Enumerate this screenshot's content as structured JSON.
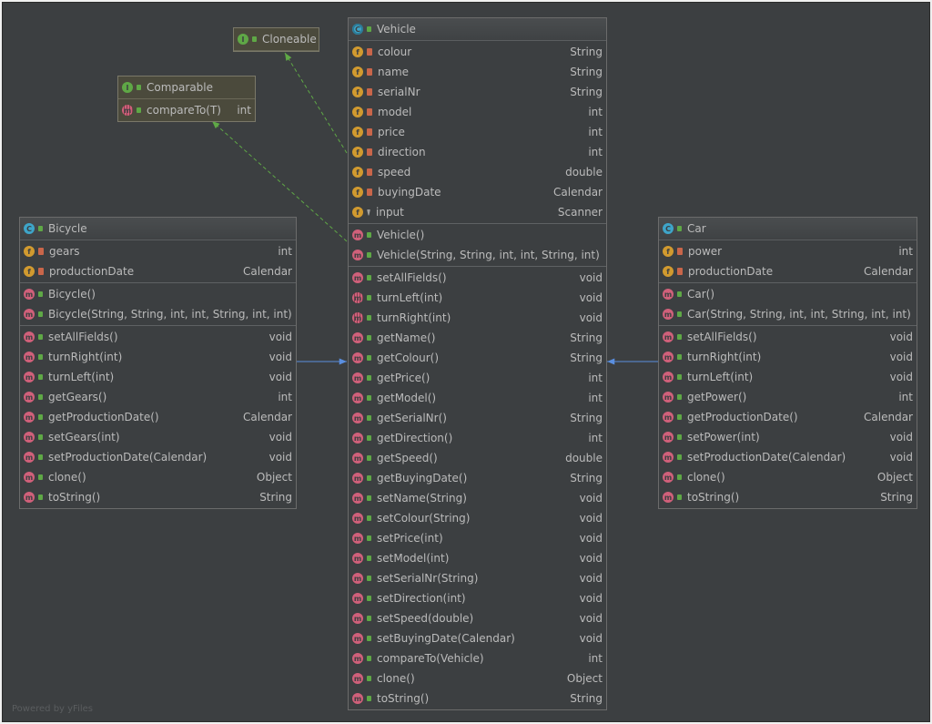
{
  "footer": "Powered by yFiles",
  "colors": {
    "background": "#3c3f41",
    "inheritance": "#5a8fe0",
    "realization": "#5fa846"
  },
  "classes": {
    "vehicle": {
      "name": "Vehicle",
      "kind": "abstract-class",
      "fields": [
        [
          "colour",
          "String",
          "private"
        ],
        [
          "name",
          "String",
          "private"
        ],
        [
          "serialNr",
          "String",
          "private"
        ],
        [
          "model",
          "int",
          "private"
        ],
        [
          "price",
          "int",
          "private"
        ],
        [
          "direction",
          "int",
          "private"
        ],
        [
          "speed",
          "double",
          "private"
        ],
        [
          "buyingDate",
          "Calendar",
          "private"
        ],
        [
          "input",
          "Scanner",
          "package"
        ]
      ],
      "constructors": [
        [
          "Vehicle()",
          "",
          "public"
        ],
        [
          "Vehicle(String, String, int, int, String, int)",
          "",
          "public"
        ]
      ],
      "methods": [
        [
          "setAllFields()",
          "void",
          "public"
        ],
        [
          "turnLeft(int)",
          "void",
          "public",
          "abstract"
        ],
        [
          "turnRight(int)",
          "void",
          "public",
          "abstract"
        ],
        [
          "getName()",
          "String",
          "public"
        ],
        [
          "getColour()",
          "String",
          "public"
        ],
        [
          "getPrice()",
          "int",
          "public"
        ],
        [
          "getModel()",
          "int",
          "public"
        ],
        [
          "getSerialNr()",
          "String",
          "public"
        ],
        [
          "getDirection()",
          "int",
          "public"
        ],
        [
          "getSpeed()",
          "double",
          "public"
        ],
        [
          "getBuyingDate()",
          "String",
          "public"
        ],
        [
          "setName(String)",
          "void",
          "public"
        ],
        [
          "setColour(String)",
          "void",
          "public"
        ],
        [
          "setPrice(int)",
          "void",
          "public"
        ],
        [
          "setModel(int)",
          "void",
          "public"
        ],
        [
          "setSerialNr(String)",
          "void",
          "public"
        ],
        [
          "setDirection(int)",
          "void",
          "public"
        ],
        [
          "setSpeed(double)",
          "void",
          "public"
        ],
        [
          "setBuyingDate(Calendar)",
          "void",
          "public"
        ],
        [
          "compareTo(Vehicle)",
          "int",
          "public"
        ],
        [
          "clone()",
          "Object",
          "public"
        ],
        [
          "toString()",
          "String",
          "public"
        ]
      ]
    },
    "bicycle": {
      "name": "Bicycle",
      "kind": "class",
      "fields": [
        [
          "gears",
          "int",
          "private"
        ],
        [
          "productionDate",
          "Calendar",
          "private"
        ]
      ],
      "constructors": [
        [
          "Bicycle()",
          "",
          "public"
        ],
        [
          "Bicycle(String, String, int, int, String, int, int)",
          "",
          "public"
        ]
      ],
      "methods": [
        [
          "setAllFields()",
          "void",
          "public"
        ],
        [
          "turnRight(int)",
          "void",
          "public"
        ],
        [
          "turnLeft(int)",
          "void",
          "public"
        ],
        [
          "getGears()",
          "int",
          "public"
        ],
        [
          "getProductionDate()",
          "Calendar",
          "public"
        ],
        [
          "setGears(int)",
          "void",
          "public"
        ],
        [
          "setProductionDate(Calendar)",
          "void",
          "public"
        ],
        [
          "clone()",
          "Object",
          "public"
        ],
        [
          "toString()",
          "String",
          "public"
        ]
      ]
    },
    "car": {
      "name": "Car",
      "kind": "class",
      "fields": [
        [
          "power",
          "int",
          "private"
        ],
        [
          "productionDate",
          "Calendar",
          "private"
        ]
      ],
      "constructors": [
        [
          "Car()",
          "",
          "public"
        ],
        [
          "Car(String, String, int, int, String, int, int)",
          "",
          "public"
        ]
      ],
      "methods": [
        [
          "setAllFields()",
          "void",
          "public"
        ],
        [
          "turnRight(int)",
          "void",
          "public"
        ],
        [
          "turnLeft(int)",
          "void",
          "public"
        ],
        [
          "getPower()",
          "int",
          "public"
        ],
        [
          "getProductionDate()",
          "Calendar",
          "public"
        ],
        [
          "setPower(int)",
          "void",
          "public"
        ],
        [
          "setProductionDate(Calendar)",
          "void",
          "public"
        ],
        [
          "clone()",
          "Object",
          "public"
        ],
        [
          "toString()",
          "String",
          "public"
        ]
      ]
    },
    "comparable": {
      "name": "Comparable",
      "kind": "interface",
      "methods": [
        [
          "compareTo(T)",
          "int",
          "public",
          "abstract"
        ]
      ]
    },
    "cloneable": {
      "name": "Cloneable",
      "kind": "interface"
    }
  },
  "edges": [
    {
      "from": "bicycle",
      "to": "vehicle",
      "type": "inheritance"
    },
    {
      "from": "car",
      "to": "vehicle",
      "type": "inheritance"
    },
    {
      "from": "vehicle",
      "to": "cloneable",
      "type": "realization"
    },
    {
      "from": "vehicle",
      "to": "comparable",
      "type": "realization"
    }
  ]
}
